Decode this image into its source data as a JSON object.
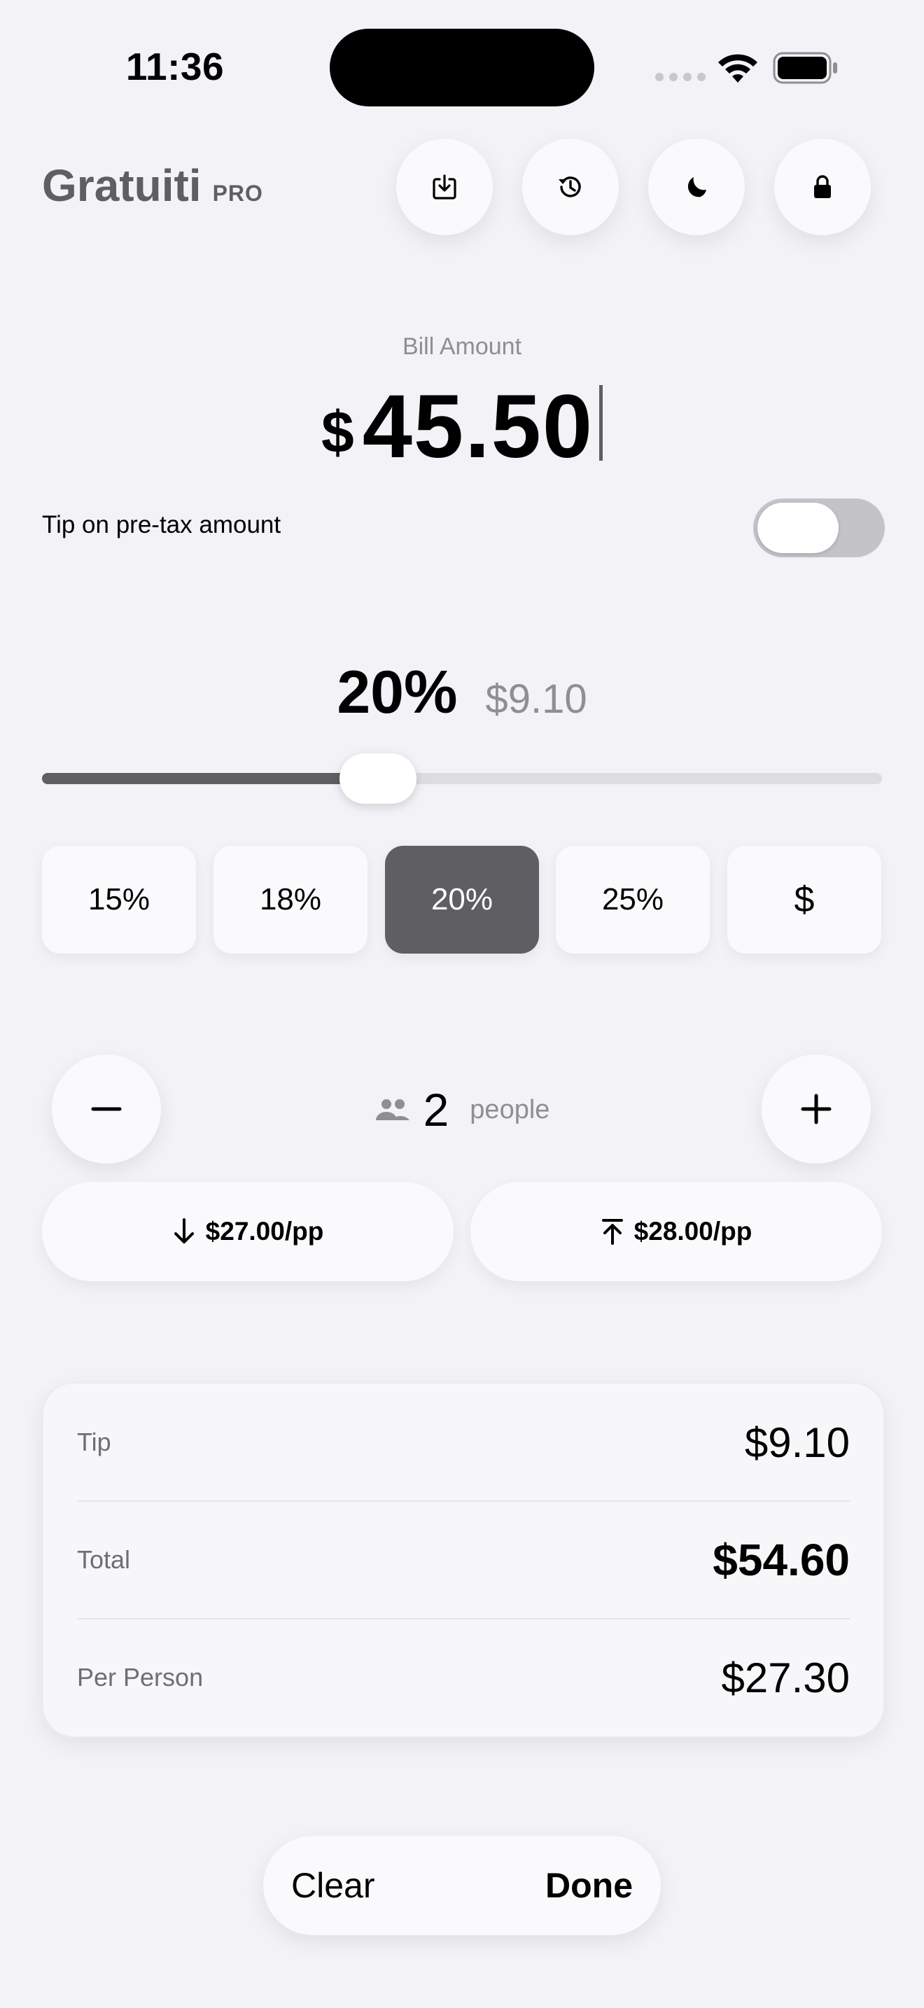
{
  "status_bar": {
    "time": "11:36"
  },
  "header": {
    "app_name": "Gratuiti",
    "badge": "PRO",
    "actions": [
      {
        "icon": "save-icon"
      },
      {
        "icon": "history-icon"
      },
      {
        "icon": "moon-icon"
      },
      {
        "icon": "lock-icon"
      }
    ]
  },
  "bill": {
    "label": "Bill Amount",
    "currency": "$",
    "value": "45.50"
  },
  "pretax": {
    "label": "Tip on pre-tax amount",
    "enabled": false
  },
  "tip": {
    "percent_label": "20%",
    "amount_label": "$9.10",
    "slider_fraction": 0.4
  },
  "presets": [
    {
      "label": "15%",
      "active": false
    },
    {
      "label": "18%",
      "active": false
    },
    {
      "label": "20%",
      "active": true
    },
    {
      "label": "25%",
      "active": false
    },
    {
      "label": "$",
      "active": false
    }
  ],
  "people": {
    "count": "2",
    "label": "people",
    "round_down_label": "$27.00/pp",
    "round_up_label": "$28.00/pp"
  },
  "summary": {
    "tip_label": "Tip",
    "tip_value": "$9.10",
    "total_label": "Total",
    "total_value": "$54.60",
    "per_person_label": "Per Person",
    "per_person_value": "$27.30"
  },
  "bottom_bar": {
    "clear_label": "Clear",
    "done_label": "Done"
  },
  "colors": {
    "background": "#F2F2F7",
    "accent": "#5E5E63",
    "secondary_text": "#8E8E93"
  }
}
